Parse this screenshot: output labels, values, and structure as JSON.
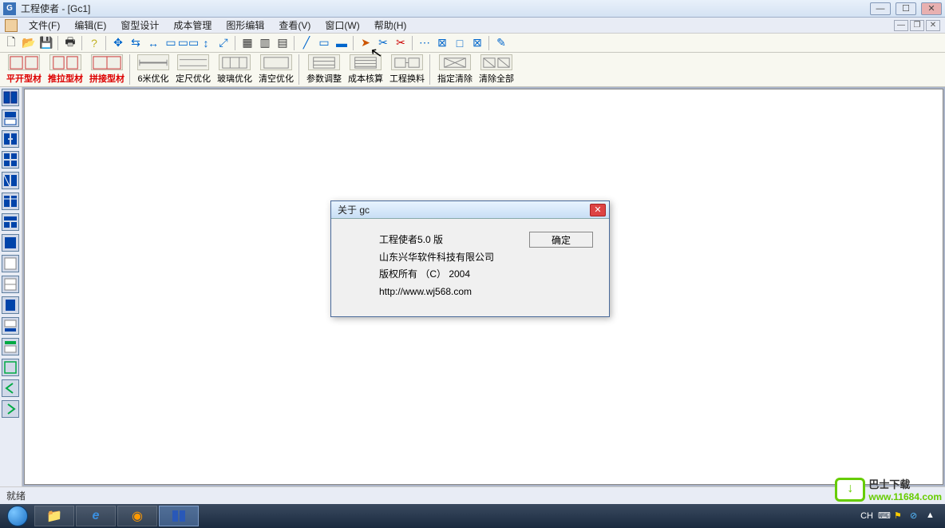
{
  "window": {
    "title": "工程使者 - [Gc1]"
  },
  "menu": {
    "file": "文件(F)",
    "edit": "编辑(E)",
    "window_design": "窗型设计",
    "cost_mgmt": "成本管理",
    "graphic_edit": "图形编辑",
    "view": "查看(V)",
    "win": "窗口(W)",
    "help": "帮助(H)"
  },
  "toolbar2": {
    "pk": "平开型材",
    "tl": "推拉型材",
    "pj": "拼接型材",
    "opt6m": "6米优化",
    "fixed": "定尺优化",
    "glass": "玻璃优化",
    "empty": "清空优化",
    "param": "参数调整",
    "cost": "成本核算",
    "convert": "工程换料",
    "delsel": "指定清除",
    "delall": "清除全部"
  },
  "status": {
    "text": "就绪"
  },
  "about": {
    "title": "关于 gc",
    "line1": "工程使者5.0 版",
    "line2": "山东兴华软件科技有限公司",
    "line3": "版权所有 （C） 2004",
    "line4": "http://www.wj568.com",
    "ok": "确定"
  },
  "tray": {
    "ime": "CH"
  },
  "watermark": {
    "cn": "巴士下载",
    "url": "www.11684.com"
  }
}
